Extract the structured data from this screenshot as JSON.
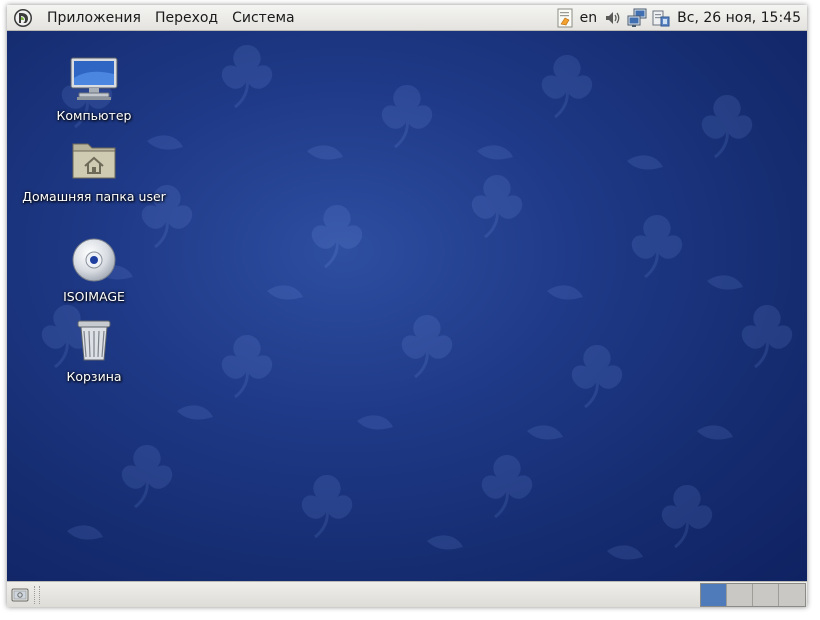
{
  "top_panel": {
    "menu": [
      "Приложения",
      "Переход",
      "Система"
    ],
    "tray": {
      "language": "en",
      "icons": [
        "notes-icon",
        "volume-icon",
        "network-icon",
        "update-icon"
      ],
      "clock": "Вс, 26 ноя, 15:45"
    }
  },
  "desktop": {
    "icons": [
      {
        "label": "Компьютер",
        "icon": "computer-icon"
      },
      {
        "label": "Домашняя папка user",
        "icon": "home-folder-icon"
      },
      {
        "label": "ISOIMAGE",
        "icon": "cd-icon"
      },
      {
        "label": "Корзина",
        "icon": "trash-icon"
      }
    ]
  },
  "bottom_panel": {
    "workspaces": {
      "count": 4,
      "active_index": 0
    },
    "colors": {
      "active": "#4f7bbb",
      "inactive": "#c9c8c4"
    }
  },
  "colors": {
    "desktop_background": "#1f3a88",
    "panel": "#e8e7e3"
  }
}
